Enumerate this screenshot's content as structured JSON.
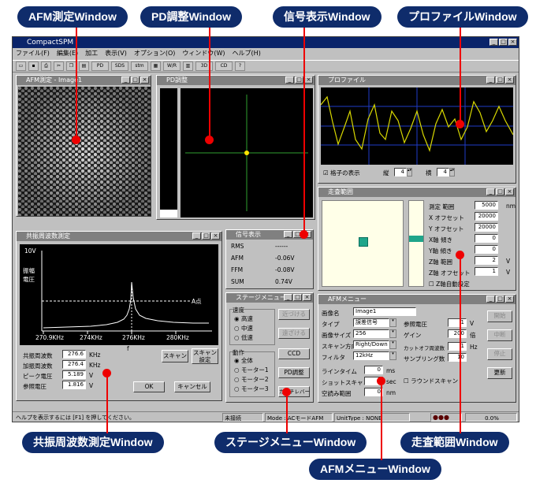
{
  "callouts": {
    "afm": "AFM測定Window",
    "pd": "PD調整Window",
    "signal": "信号表示Window",
    "profile": "プロファイルWindow",
    "resonance": "共振周波数測定Window",
    "stage": "ステージメニューWindow",
    "scan": "走査範囲Window",
    "afm_menu": "AFMメニューWindow"
  },
  "app": {
    "title": "CompactSPM",
    "menus": [
      "ファイル(F)",
      "編集(E)",
      "加工",
      "表示(V)",
      "オプション(O)",
      "ウィンドウ(W)",
      "ヘルプ(H)"
    ],
    "toolbar_labels": [
      "PD",
      "SDS",
      "stm",
      "W/R",
      "3D",
      "CD",
      "?"
    ]
  },
  "afm_window": {
    "title": "AFM測定 - Image1"
  },
  "pd_window": {
    "title": "PD調整"
  },
  "profile_window": {
    "title": "プロファイル",
    "grid_label": "格子の表示",
    "vert_label": "縦",
    "vert_value": "4",
    "horiz_label": "横",
    "horiz_value": "4"
  },
  "scan_window": {
    "title": "走査範囲",
    "rows": [
      {
        "label": "測定 範囲",
        "value": "5000",
        "unit": "nm"
      },
      {
        "label": "X オフセット",
        "value": "20000",
        "unit": ""
      },
      {
        "label": "Y オフセット",
        "value": "20000",
        "unit": ""
      },
      {
        "label": "X軸 傾き",
        "value": "0",
        "unit": ""
      },
      {
        "label": "Y軸 傾き",
        "value": "0",
        "unit": ""
      },
      {
        "label": "Z軸 範囲",
        "value": "2",
        "unit": "V"
      },
      {
        "label": "Z軸 オフセット",
        "value": "1",
        "unit": "V"
      }
    ],
    "auto_label": "Z軸自動設定"
  },
  "signal_window": {
    "title": "信号表示",
    "rows": [
      {
        "label": "RMS",
        "value": "------"
      },
      {
        "label": "AFM",
        "value": "-0.06V"
      },
      {
        "label": "FFM",
        "value": "-0.08V"
      },
      {
        "label": "SUM",
        "value": "0.74V"
      }
    ]
  },
  "resonance_window": {
    "title": "共振周波数測定",
    "y_top": "10V",
    "y_label_1": "振幅",
    "y_label_2": "電圧",
    "point_label": "A点",
    "x_ticks": [
      "270.9KHz",
      "274KHz",
      "276KHz",
      "280KHz"
    ],
    "x_axis_f": "f",
    "fields": [
      {
        "label": "共振周波数",
        "value": "276.6",
        "unit": "KHz"
      },
      {
        "label": "加振周波数",
        "value": "276.4",
        "unit": "KHz"
      },
      {
        "label": "ピーク電圧",
        "value": "5.189",
        "unit": "V"
      },
      {
        "label": "参照電圧",
        "value": "1.816",
        "unit": "V"
      }
    ],
    "scan_btn": "スキャン",
    "scan_setting_btn_1": "スキャン",
    "scan_setting_btn_2": "設定",
    "ok_btn": "OK",
    "cancel_btn": "キャンセル"
  },
  "stage_window": {
    "title": "ステージメニュー",
    "speed_group": "速度",
    "speeds": [
      "高速",
      "中速",
      "低速"
    ],
    "action_group": "動作",
    "actions": [
      "全体",
      "モーター1",
      "モーター2",
      "モーター3"
    ],
    "btn_approach": "近づける",
    "btn_retract": "遠ざける",
    "btn_ccd": "CCD",
    "btn_pd": "PD調整",
    "btn_cantilever": "カンチレバー"
  },
  "afm_menu": {
    "title": "AFMメニュー",
    "image_name_label": "画像名",
    "image_name": "Image1",
    "type_label": "タイプ",
    "type_value": "誤差信号",
    "size_label": "画像サイズ",
    "size_value": "256",
    "dir_label": "スキャン方向",
    "dir_value": "Right/Down",
    "filter_label": "フィルタ",
    "filter_value": "12kHz",
    "ref_label": "参照電圧",
    "ref_value": "1",
    "ref_unit": "V",
    "gain_label": "ゲイン",
    "gain_value": "200",
    "gain_unit": "倍",
    "cutoff_label": "カットオフ周波数",
    "cutoff_value": "1",
    "cutoff_unit": "Hz",
    "sampling_label": "サンプリング数",
    "sampling_value": "10",
    "linetime_label": "ラインタイム",
    "linetime_value": "0",
    "linetime_unit": "ms",
    "shot_label": "ショットスキャン",
    "shot_value": "0",
    "shot_unit": "sec",
    "empty_label": "空読み範囲",
    "empty_value": "0",
    "empty_unit": "nm",
    "round_label": "ラウンドスキャン",
    "btn_start": "開始",
    "btn_pause": "中断",
    "btn_stop": "停止",
    "btn_update": "更新"
  },
  "status": {
    "help": "ヘルプを表示するには [F1] を押してください。",
    "conn": "未接続",
    "mode": "Mode : ACモードAFM",
    "unit": "UnitType : NONE",
    "percent": "0.0%"
  },
  "chart_data": {
    "type": "line",
    "x_ticks": [
      "270.9KHz",
      "274KHz",
      "276KHz",
      "280KHz"
    ],
    "y_top_label": "10V",
    "annotations": [
      "A点"
    ]
  }
}
